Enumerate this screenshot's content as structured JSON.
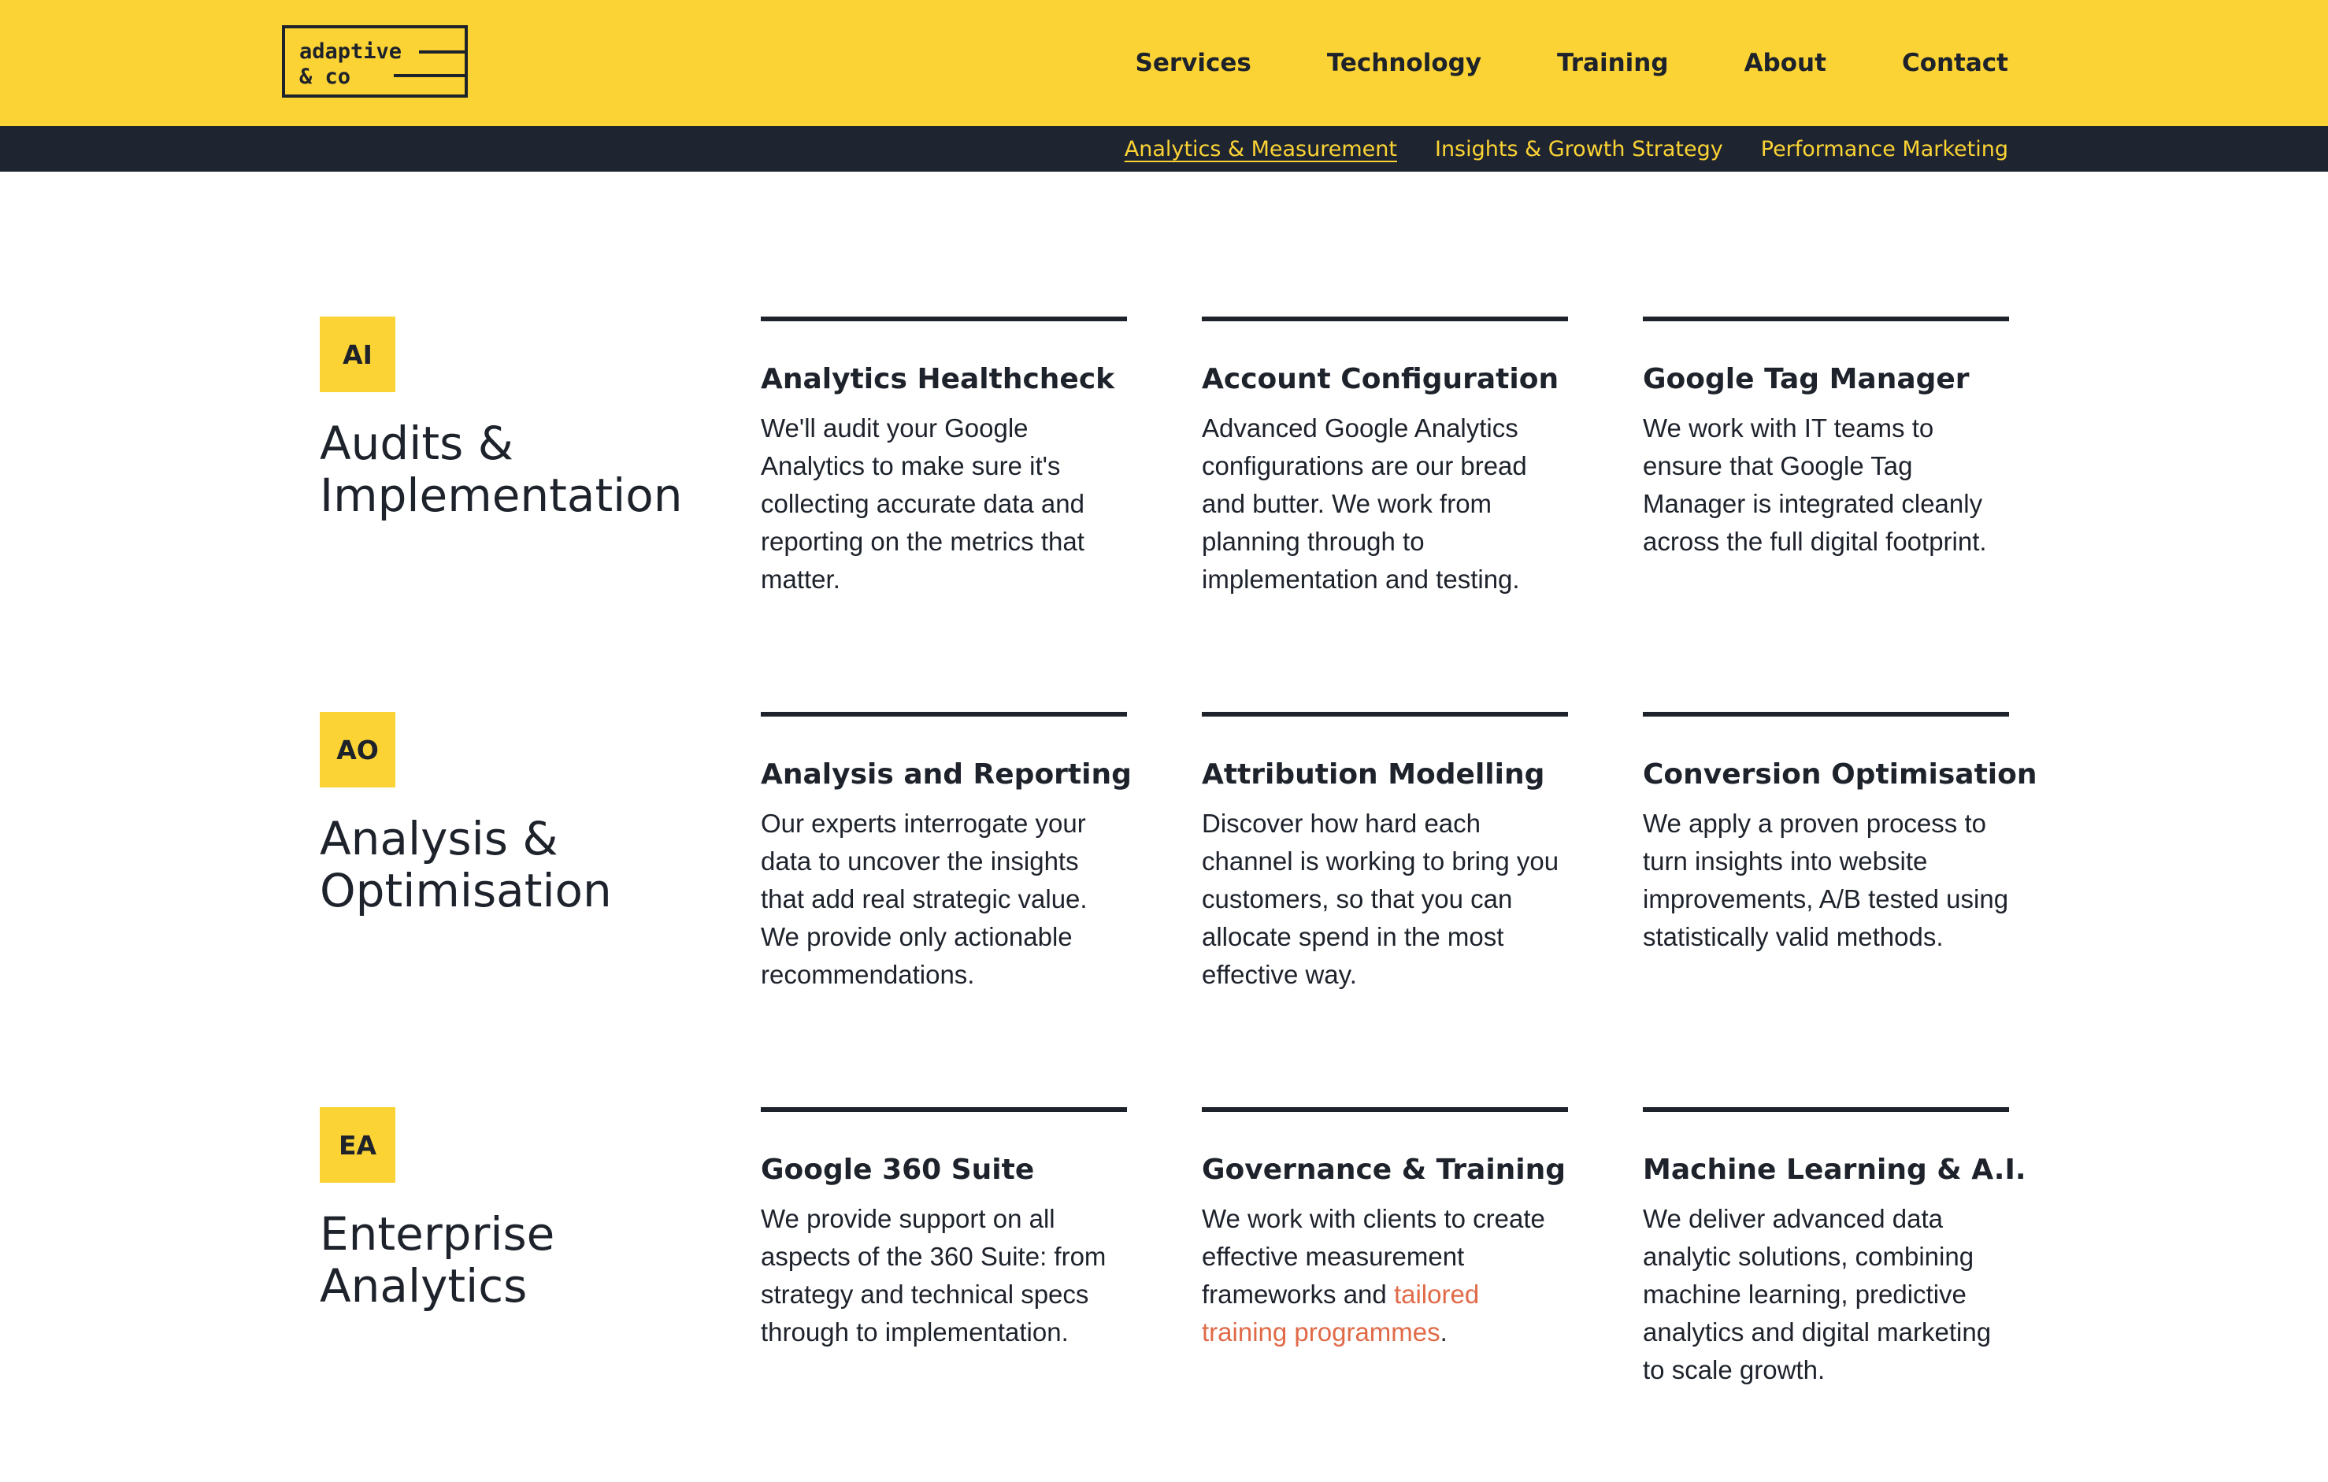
{
  "logo": {
    "line1": "adaptive",
    "line2": "& co"
  },
  "nav": {
    "items": [
      "Services",
      "Technology",
      "Training",
      "About",
      "Contact"
    ]
  },
  "subnav": {
    "items": [
      "Analytics & Measurement",
      "Insights & Growth Strategy",
      "Performance Marketing"
    ],
    "active": "Analytics & Measurement"
  },
  "colors": {
    "accent": "#fbd334",
    "dark": "#1d222b",
    "link": "#e06a48"
  },
  "sections": [
    {
      "badge": "AI",
      "title": "Audits & Implementation",
      "cards": [
        {
          "title": "Analytics Healthcheck",
          "body": "We'll audit your Google Analytics to make sure it's collecting accurate data and reporting on the metrics that matter."
        },
        {
          "title": "Account Configuration",
          "body": "Advanced Google Analytics configurations are our bread and butter. We work from planning through to implementation and testing."
        },
        {
          "title": "Google Tag Manager",
          "body": "We work with IT teams to ensure that Google Tag Manager is integrated cleanly across the full digital footprint."
        }
      ]
    },
    {
      "badge": "AO",
      "title": "Analysis & Optimisation",
      "cards": [
        {
          "title": "Analysis and Reporting",
          "body": "Our experts interrogate your data to uncover the insights that add real strategic value. We provide only actionable recommendations."
        },
        {
          "title": "Attribution Modelling",
          "body": "Discover how hard each channel is working to bring you customers, so that you can allocate spend in the most effective way."
        },
        {
          "title": "Conversion Optimisation",
          "body": "We apply a proven process to turn insights into website improvements, A/B tested using statistically valid methods."
        }
      ]
    },
    {
      "badge": "EA",
      "title": "Enterprise Analytics",
      "cards": [
        {
          "title": "Google 360 Suite",
          "body": "We provide support on all aspects of the 360 Suite: from strategy and technical specs through to implementation."
        },
        {
          "title": "Governance & Training",
          "body_before": "We work with clients to create effective measurement frameworks and ",
          "link": "tailored training programmes",
          "body_after": "."
        },
        {
          "title": "Machine Learning & A.I.",
          "body": "We deliver advanced data analytic solutions, combining machine learning, predictive analytics and digital marketing to scale growth."
        }
      ]
    }
  ]
}
